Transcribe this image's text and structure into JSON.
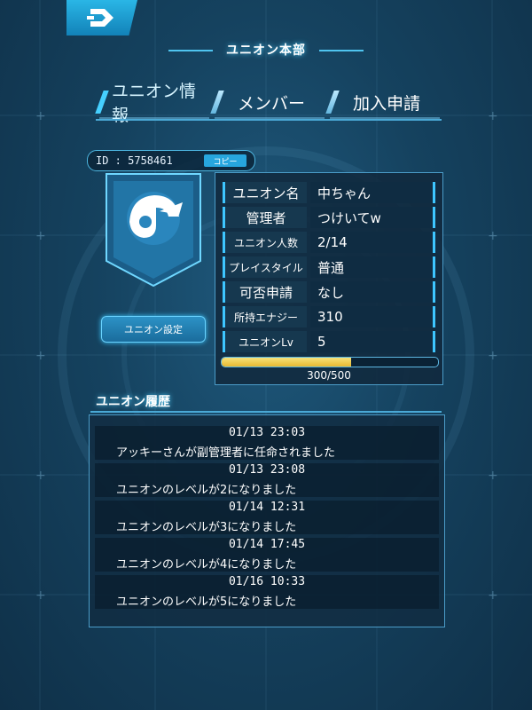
{
  "header": {
    "title": "ユニオン本部"
  },
  "tabs": [
    {
      "label": "ユニオン情報",
      "active": true
    },
    {
      "label": "メンバー",
      "active": false
    },
    {
      "label": "加入申請",
      "active": false
    }
  ],
  "id_bar": {
    "id_text": "ID : 5758461",
    "copy_label": "コピー"
  },
  "emblem": {
    "icon": "helmet-emblem-icon"
  },
  "settings_button": {
    "label": "ユニオン設定"
  },
  "info": {
    "rows": [
      {
        "label": "ユニオン名",
        "value": "中ちゃん"
      },
      {
        "label": "管理者",
        "value": "つけいてw"
      },
      {
        "label": "ユニオン人数",
        "value": "2/14"
      },
      {
        "label": "プレイスタイル",
        "value": "普通"
      },
      {
        "label": "可否申請",
        "value": "なし"
      },
      {
        "label": "所持エナジー",
        "value": "310"
      },
      {
        "label": "ユニオンLv",
        "value": "5"
      }
    ],
    "progress_text": "300/500",
    "progress_value": 0.6
  },
  "history": {
    "title": "ユニオン履歴",
    "entries": [
      {
        "time": "01/13 23:03",
        "text": "アッキーさんが副管理者に任命されました"
      },
      {
        "time": "01/13 23:08",
        "text": "ユニオンのレベルが2になりました"
      },
      {
        "time": "01/14 12:31",
        "text": "ユニオンのレベルが3になりました"
      },
      {
        "time": "01/14 17:45",
        "text": "ユニオンのレベルが4になりました"
      },
      {
        "time": "01/16 10:33",
        "text": "ユニオンのレベルが5になりました"
      }
    ]
  },
  "colors": {
    "accent": "#3ec6ff",
    "progress": "#e8b931",
    "panel": "#102c42"
  }
}
